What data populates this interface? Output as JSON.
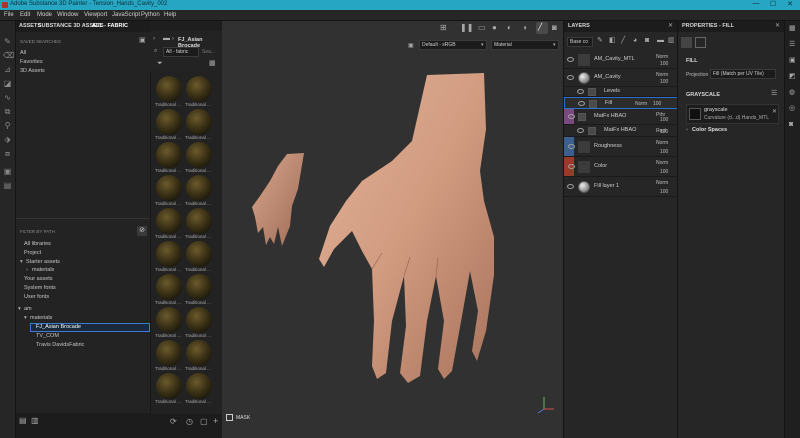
{
  "window": {
    "title": "Adobe Substance 3D Painter - Tension_Hands_Cavity_002",
    "controls": [
      "—",
      "☐",
      "✕"
    ]
  },
  "menu": [
    "File",
    "Edit",
    "Mode",
    "Window",
    "Viewport",
    "JavaScript",
    "Python",
    "Help"
  ],
  "assets": {
    "tabs": [
      "ASSETS",
      "SUBSTANCE 3D ASSETS",
      "ALL - FABRIC"
    ],
    "saved_searches_label": "SAVED SEARCHES",
    "saved_searches": [
      "All",
      "Favorites",
      "3D Assets"
    ],
    "filter_label": "FILTER BY PATH",
    "tree": [
      {
        "label": "All libraries",
        "level": 0
      },
      {
        "label": "Project",
        "level": 0
      },
      {
        "label": "Starter assets",
        "level": 0,
        "arrow": "▾"
      },
      {
        "label": "materials",
        "level": 1,
        "arrow": "›"
      },
      {
        "label": "Your assets",
        "level": 0
      },
      {
        "label": "System fonts",
        "level": 0
      },
      {
        "label": "User fonts",
        "level": 0
      }
    ],
    "tree2": [
      {
        "label": "am",
        "level": 0,
        "arrow": "▾"
      },
      {
        "label": "materials",
        "level": 1,
        "arrow": "▾"
      },
      {
        "label": "FJ_Asian Brocade",
        "level": 2,
        "selected": true
      },
      {
        "label": "TV_COM",
        "level": 2
      },
      {
        "label": "Travis DavidsFabric",
        "level": 2
      }
    ]
  },
  "browser": {
    "breadcrumb": "FJ_Asian Brocade",
    "search_tag": "All - fabric",
    "search_placeholder": "Sea...",
    "thumb_label": "Traditional ...",
    "thumb_rows": 15
  },
  "viewport": {
    "colorspace": "Default - sRGB",
    "channel": "Material",
    "mask_label": "MASK"
  },
  "layers": {
    "title": "LAYERS",
    "channel_select": "Base co",
    "items": [
      {
        "name": "AM_Cavity_MTL",
        "blend": "Norm",
        "opacity": "100",
        "color": "",
        "type": "folder"
      },
      {
        "name": "AM_Cavity",
        "blend": "Norm",
        "opacity": "100",
        "color": "",
        "type": "sphere"
      },
      {
        "name": "Levels",
        "blend": "",
        "opacity": "",
        "color": "",
        "type": "effect"
      },
      {
        "name": "Fill",
        "blend": "Norm",
        "opacity": "100",
        "color": "",
        "type": "fill-effect"
      },
      {
        "name": "MatFx HBAO",
        "blend": "Pthr",
        "opacity": "100",
        "color": "#7a4a7e",
        "type": "brush"
      },
      {
        "name": "MatFx HBAO",
        "blend": "Repl",
        "opacity": "100",
        "color": "",
        "type": "effect"
      },
      {
        "name": "Roughness",
        "blend": "Norm",
        "opacity": "100",
        "color": "#3b5f8f",
        "type": "folder"
      },
      {
        "name": "Color",
        "blend": "Norm",
        "opacity": "100",
        "color": "#9a3a2a",
        "type": "folder"
      },
      {
        "name": "Fill layer 1",
        "blend": "Norm",
        "opacity": "100",
        "color": "",
        "type": "sphere"
      }
    ]
  },
  "properties": {
    "title": "PROPERTIES - FILL",
    "fill_header": "FILL",
    "projection_label": "Projection",
    "projection_value": "Fill (Match per UV Tile)",
    "grayscale_header": "GRAYSCALE",
    "grayscale_name": "grayscale",
    "grayscale_source": "Curvature (d...d) Hands_MTL",
    "color_spaces": "Color Spaces"
  },
  "colors": {
    "titlebar": "#26a6c2",
    "panel": "#262626",
    "viewport_bg": "#313131",
    "selection": "#2a6fc9",
    "skin": "#d9a58a"
  }
}
